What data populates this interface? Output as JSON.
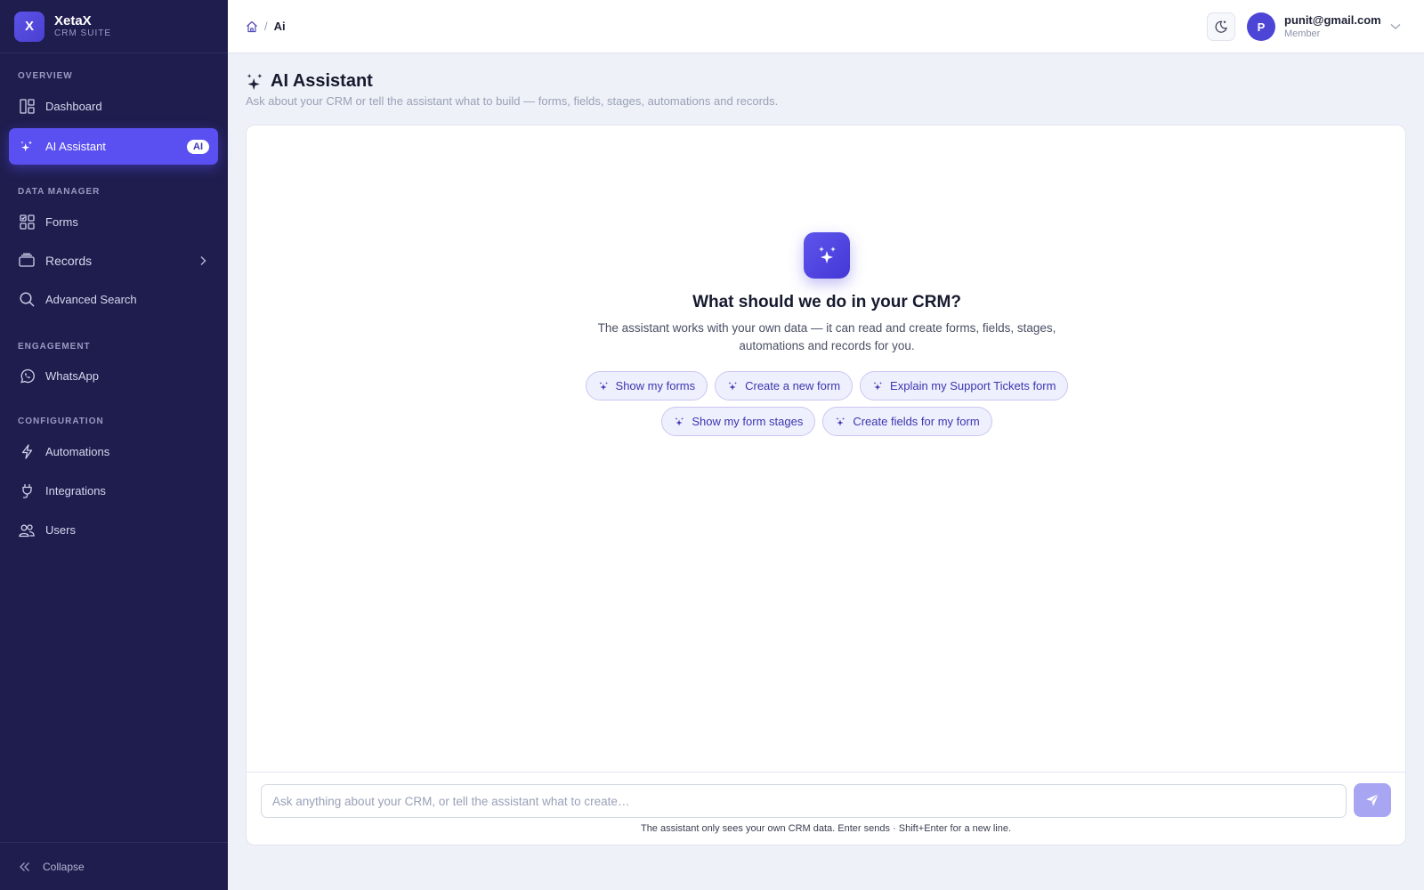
{
  "brand": {
    "logo_letter": "X",
    "name": "XetaX",
    "subtitle": "CRM SUITE"
  },
  "sidebar": {
    "sections": [
      {
        "label": "OVERVIEW"
      },
      {
        "label": "DATA MANAGER"
      },
      {
        "label": "ENGAGEMENT"
      },
      {
        "label": "CONFIGURATION"
      }
    ],
    "items": [
      {
        "label": "Dashboard",
        "icon": "dashboard-icon"
      },
      {
        "label": "AI Assistant",
        "icon": "sparkles-icon",
        "badge": "AI",
        "active": true
      },
      {
        "label": "Forms",
        "icon": "forms-icon"
      },
      {
        "label": "Records",
        "icon": "records-icon",
        "has_submenu": true
      },
      {
        "label": "Advanced Search",
        "icon": "search-icon"
      },
      {
        "label": "WhatsApp",
        "icon": "whatsapp-icon"
      },
      {
        "label": "Automations",
        "icon": "lightning-icon"
      },
      {
        "label": "Integrations",
        "icon": "plug-icon"
      },
      {
        "label": "Users",
        "icon": "users-icon"
      }
    ],
    "collapse_label": "Collapse"
  },
  "topbar": {
    "breadcrumb_separator": "/",
    "breadcrumb_current": "Ai",
    "user": {
      "initial": "P",
      "email": "punit@gmail.com",
      "role": "Member"
    }
  },
  "page": {
    "title": "AI Assistant",
    "subtitle": "Ask about your CRM or tell the assistant what to build — forms, fields, stages, automations and records."
  },
  "assistant": {
    "heading": "What should we do in your CRM?",
    "description": "The assistant works with your own data — it can read and create forms, fields, stages, automations and records for you.",
    "suggestions": [
      "Show my forms",
      "Create a new form",
      "Explain my Support Tickets form",
      "Show my form stages",
      "Create fields for my form"
    ],
    "input_placeholder": "Ask anything about your CRM, or tell the assistant what to create…",
    "input_value": "",
    "hint": "The assistant only sees your own CRM data. Enter sends · Shift+Enter for a new line."
  },
  "colors": {
    "sidebar_bg": "#1f1d4e",
    "accent": "#5a4ff0",
    "chip_bg": "#eef0fd",
    "send_button": "#a8a6f3"
  }
}
